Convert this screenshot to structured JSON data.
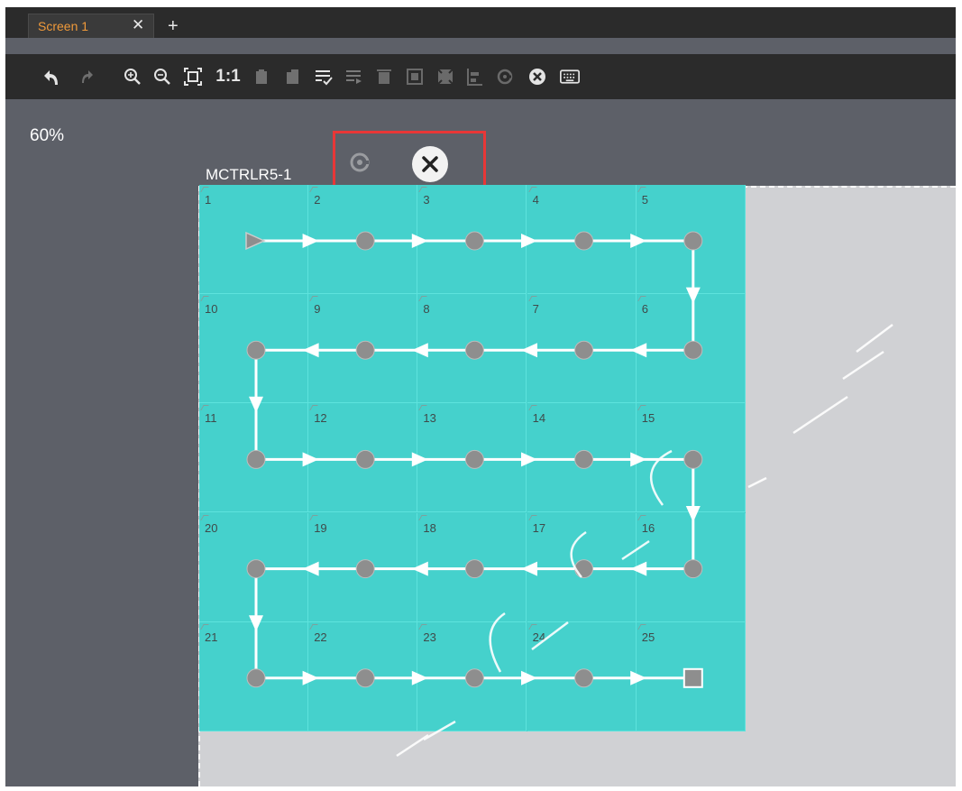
{
  "tabs": [
    {
      "label": "Screen 1",
      "active": true,
      "close_icon": "close-icon"
    }
  ],
  "tab_add_icon": "plus-icon",
  "toolbar": {
    "items": [
      {
        "name": "undo-icon",
        "enabled": true
      },
      {
        "name": "redo-icon",
        "enabled": false
      },
      {
        "name": "zoom-in-icon",
        "enabled": true
      },
      {
        "name": "zoom-out-icon",
        "enabled": true
      },
      {
        "name": "fit-screen-icon",
        "enabled": true
      },
      {
        "name": "actual-size-label",
        "text": "1:1",
        "enabled": true
      },
      {
        "name": "copy-icon",
        "enabled": false
      },
      {
        "name": "paste-icon",
        "enabled": false
      },
      {
        "name": "batch-edit-icon",
        "enabled": true
      },
      {
        "name": "list-icon",
        "enabled": false
      },
      {
        "name": "delete-icon",
        "enabled": false
      },
      {
        "name": "frame-icon",
        "enabled": false
      },
      {
        "name": "fill-icon",
        "enabled": false
      },
      {
        "name": "align-icon",
        "enabled": false
      },
      {
        "name": "rotate-icon",
        "enabled": false
      },
      {
        "name": "clear-icon",
        "enabled": true
      },
      {
        "name": "keyboard-icon",
        "enabled": true
      }
    ]
  },
  "zoom": "60%",
  "receiver": {
    "name": "MCTRLR5-1",
    "rotate_icon": "rotate-icon",
    "clear_icon": "clear-icon"
  },
  "grid": {
    "rows": 5,
    "cols": 5,
    "cells": [
      [
        "1",
        "2",
        "3",
        "4",
        "5"
      ],
      [
        "10",
        "9",
        "8",
        "7",
        "6"
      ],
      [
        "11",
        "12",
        "13",
        "14",
        "15"
      ],
      [
        "20",
        "19",
        "18",
        "17",
        "16"
      ],
      [
        "21",
        "22",
        "23",
        "24",
        "25"
      ]
    ]
  },
  "colors": {
    "cabinet": "#45d1cc",
    "highlight": "#e83737",
    "tab_active_text": "#f09a3a"
  }
}
